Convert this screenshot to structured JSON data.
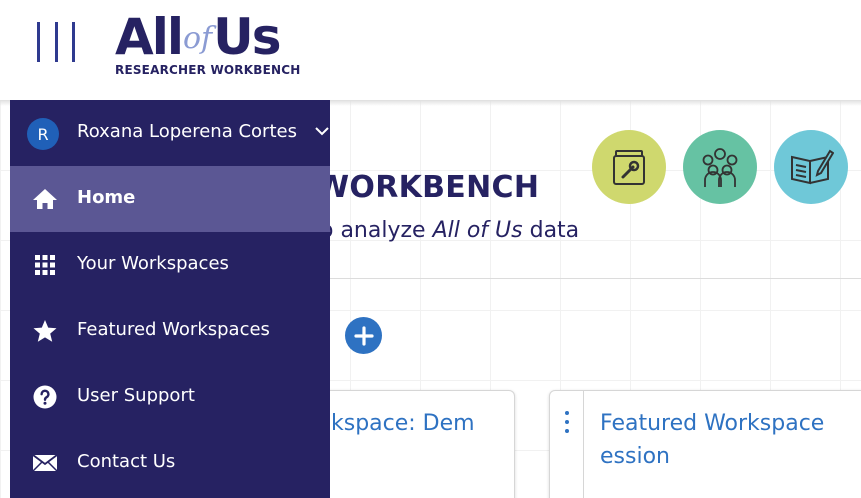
{
  "header": {
    "logo": {
      "all": "All",
      "of": "of",
      "us": "Us",
      "subtitle": "RESEARCHER WORKBENCH"
    }
  },
  "hero": {
    "title_fragment": "WORKBENCH",
    "subtitle_prefix": "o analyze ",
    "subtitle_emphasis": "All of Us",
    "subtitle_suffix": " data"
  },
  "quick_links": [
    {
      "icon": "toolbox-icon",
      "color": "#cfd86e"
    },
    {
      "icon": "people-icon",
      "color": "#66c2a3"
    },
    {
      "icon": "book-pencil-icon",
      "color": "#6fc8d8"
    }
  ],
  "cards": [
    {
      "title": "kspace: Dem"
    },
    {
      "title": "Featured Workspace ession"
    }
  ],
  "sidebar": {
    "user": {
      "initial": "R",
      "name": "Roxana Loperena Cortes"
    },
    "items": [
      {
        "label": "Home",
        "icon": "home-icon",
        "active": true
      },
      {
        "label": "Your Workspaces",
        "icon": "grid-icon",
        "active": false
      },
      {
        "label": "Featured Workspaces",
        "icon": "star-icon",
        "active": false
      },
      {
        "label": "User Support",
        "icon": "help-circle-icon",
        "active": false
      },
      {
        "label": "Contact Us",
        "icon": "envelope-icon",
        "active": false
      }
    ]
  },
  "colors": {
    "sidebar_bg": "#262262",
    "sidebar_active": "#5b5794",
    "accent_blue": "#2e72c2",
    "brand_navy": "#262262"
  }
}
